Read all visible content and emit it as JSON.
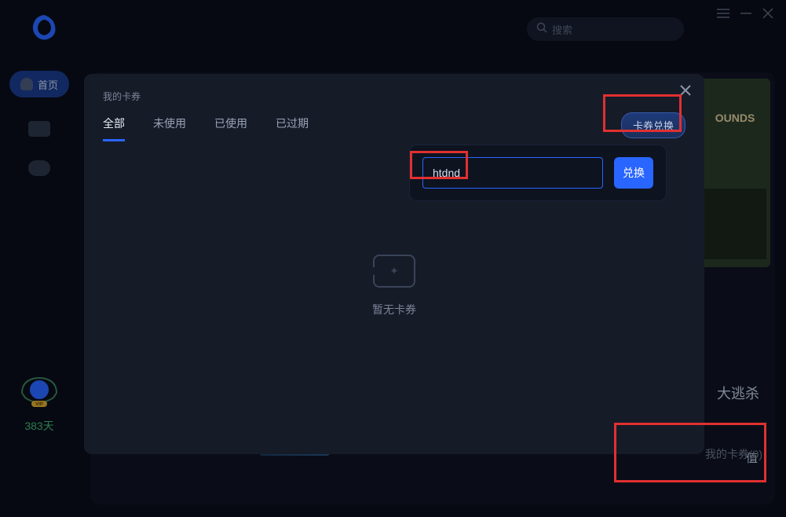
{
  "header": {
    "search_placeholder": "搜索"
  },
  "sidebar": {
    "home_label": "首页",
    "vip_days": "383天"
  },
  "background": {
    "game_title": "大逃杀",
    "charge_label": "值",
    "my_coupons_label": "我的卡券(0)"
  },
  "modal": {
    "title": "我的卡券",
    "exchange_button": "卡券兑换",
    "tabs": {
      "all": "全部",
      "unused": "未使用",
      "used": "已使用",
      "expired": "已过期"
    },
    "redeem": {
      "input_value": "htdnd",
      "submit_label": "兑换"
    },
    "empty_text": "暂无卡券"
  }
}
